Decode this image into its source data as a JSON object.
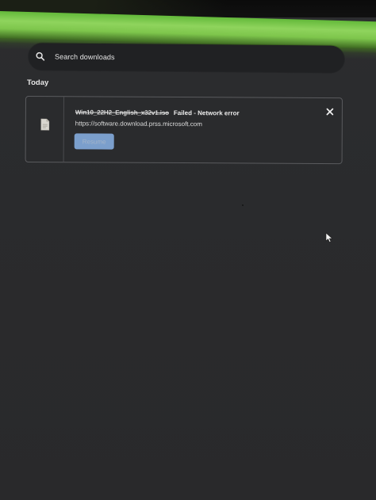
{
  "search": {
    "placeholder": "Search downloads",
    "icon": "search-icon"
  },
  "sections": [
    {
      "title": "Today",
      "items": [
        {
          "file_name": "Win10_22H2_English_x32v1.iso",
          "status": "Failed - Network error",
          "source_url": "https://software.download.prss.microsoft.com",
          "action_label": "Resume",
          "icon": "file-icon",
          "remove_icon": "close-icon"
        }
      ]
    }
  ],
  "colors": {
    "background": "#2c2d2f",
    "search_bar": "#202123",
    "card_border": "#5a5b5e",
    "resume_button": "#8ab4e8",
    "glare": "#8fd45d"
  }
}
